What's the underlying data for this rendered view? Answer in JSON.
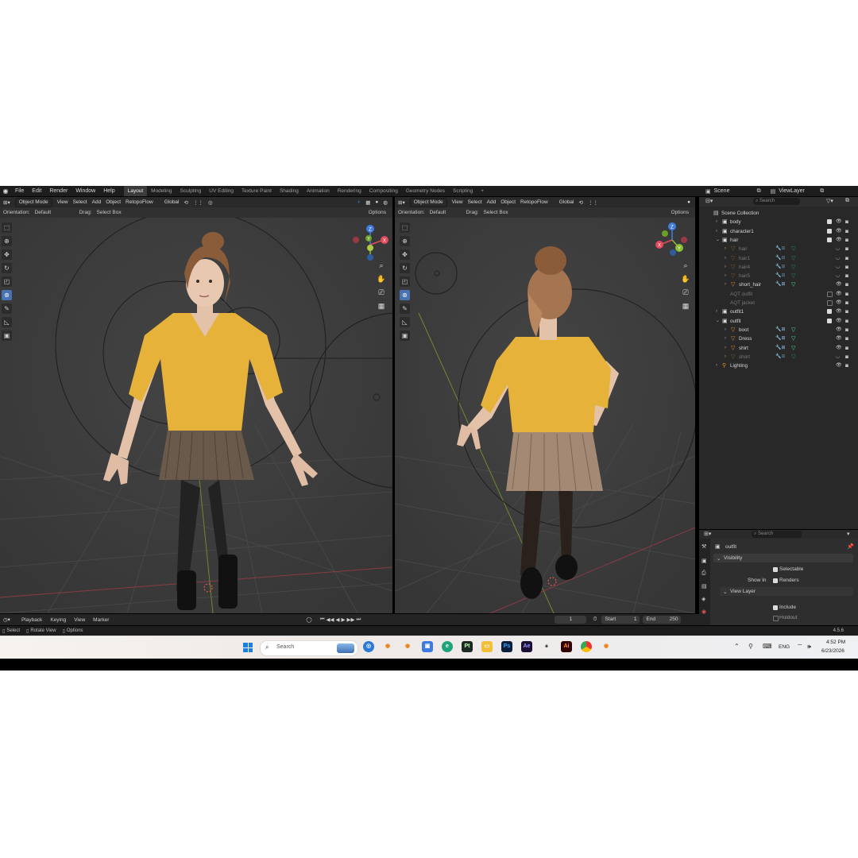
{
  "menu": {
    "items": [
      "File",
      "Edit",
      "Render",
      "Window",
      "Help"
    ],
    "workspaces": [
      "Layout",
      "Modeling",
      "Sculpting",
      "UV Editing",
      "Texture Paint",
      "Shading",
      "Animation",
      "Rendering",
      "Compositing",
      "Geometry Nodes",
      "Scripting"
    ],
    "active_workspace": "Layout",
    "add_tab": "+"
  },
  "scene": {
    "name": "Scene",
    "view_layer": "ViewLayer"
  },
  "viewport_left": {
    "mode": "Object Mode",
    "menus": [
      "View",
      "Select",
      "Add",
      "Object",
      "RetopoFlow"
    ],
    "transform": "Global",
    "orientation_label": "Orientation:",
    "orientation": "Default",
    "drag_label": "Drag:",
    "drag": "Select Box",
    "options": "Options"
  },
  "viewport_right": {
    "mode": "Object Mode",
    "menus": [
      "View",
      "Select",
      "Add",
      "Object",
      "RetopoFlow"
    ],
    "transform": "Global",
    "orientation_label": "Orientation:",
    "orientation": "Default",
    "drag_label": "Drag:",
    "drag": "Select Box",
    "options": "Options"
  },
  "gizmo": {
    "x": "X",
    "y": "Y",
    "z": "Z"
  },
  "outliner": {
    "search_placeholder": "Search",
    "rows": [
      {
        "label": "Scene Collection",
        "indent": 0,
        "type": "scene",
        "dim": false
      },
      {
        "label": "body",
        "indent": 1,
        "type": "collection",
        "dim": false
      },
      {
        "label": "character1",
        "indent": 1,
        "type": "collection",
        "dim": false
      },
      {
        "label": "hair",
        "indent": 1,
        "type": "collection",
        "dim": false
      },
      {
        "label": "hair",
        "indent": 2,
        "type": "mesh",
        "dim": true
      },
      {
        "label": "hair1",
        "indent": 2,
        "type": "mesh",
        "dim": true
      },
      {
        "label": "hair4",
        "indent": 2,
        "type": "mesh",
        "dim": true
      },
      {
        "label": "hair5",
        "indent": 2,
        "type": "mesh",
        "dim": true
      },
      {
        "label": "short_hair",
        "indent": 2,
        "type": "mesh",
        "dim": false
      },
      {
        "label": "AQT outfit",
        "indent": 1,
        "type": "plain",
        "dim": true
      },
      {
        "label": "AQT jacket",
        "indent": 1,
        "type": "plain",
        "dim": true
      },
      {
        "label": "outfit1",
        "indent": 1,
        "type": "collection",
        "dim": false
      },
      {
        "label": "outfit",
        "indent": 1,
        "type": "collection",
        "dim": false
      },
      {
        "label": "boot",
        "indent": 2,
        "type": "mesh",
        "dim": false
      },
      {
        "label": "Dress",
        "indent": 2,
        "type": "mesh",
        "dim": false
      },
      {
        "label": "shirt",
        "indent": 2,
        "type": "mesh",
        "dim": false
      },
      {
        "label": "short",
        "indent": 2,
        "type": "mesh",
        "dim": true
      },
      {
        "label": "Lighting",
        "indent": 1,
        "type": "light",
        "dim": false
      }
    ]
  },
  "properties": {
    "search_placeholder": "Search",
    "object": "outfit",
    "visibility": "Visibility",
    "selectable": "Selectable",
    "show_in": "Show In",
    "renders": "Renders",
    "view_layer": "View Layer",
    "include": "Include",
    "holdout": "Holdout"
  },
  "timeline": {
    "menus": [
      "Playback",
      "Keying",
      "View",
      "Marker"
    ],
    "frame": "1",
    "start_label": "Start",
    "start": "1",
    "end_label": "End",
    "end": "250"
  },
  "statusbar": {
    "select": "Select",
    "rotate": "Rotate View",
    "options": "Options",
    "version": "4.5.6"
  },
  "taskbar": {
    "search": "Search",
    "lang": "ENG",
    "time": "4:52 PM",
    "date": "6/23/2026",
    "apps": [
      "Pt",
      "Ps",
      "Ae",
      "Ai"
    ]
  },
  "colors": {
    "accent": "#4772b3",
    "viewport_bg": "#3a3a3a",
    "sweater": "#e7b23a",
    "skirt": "#6a5a4c",
    "axis_x": "#e34a5b",
    "axis_y": "#8cbf34",
    "axis_z": "#3f7ee0"
  }
}
